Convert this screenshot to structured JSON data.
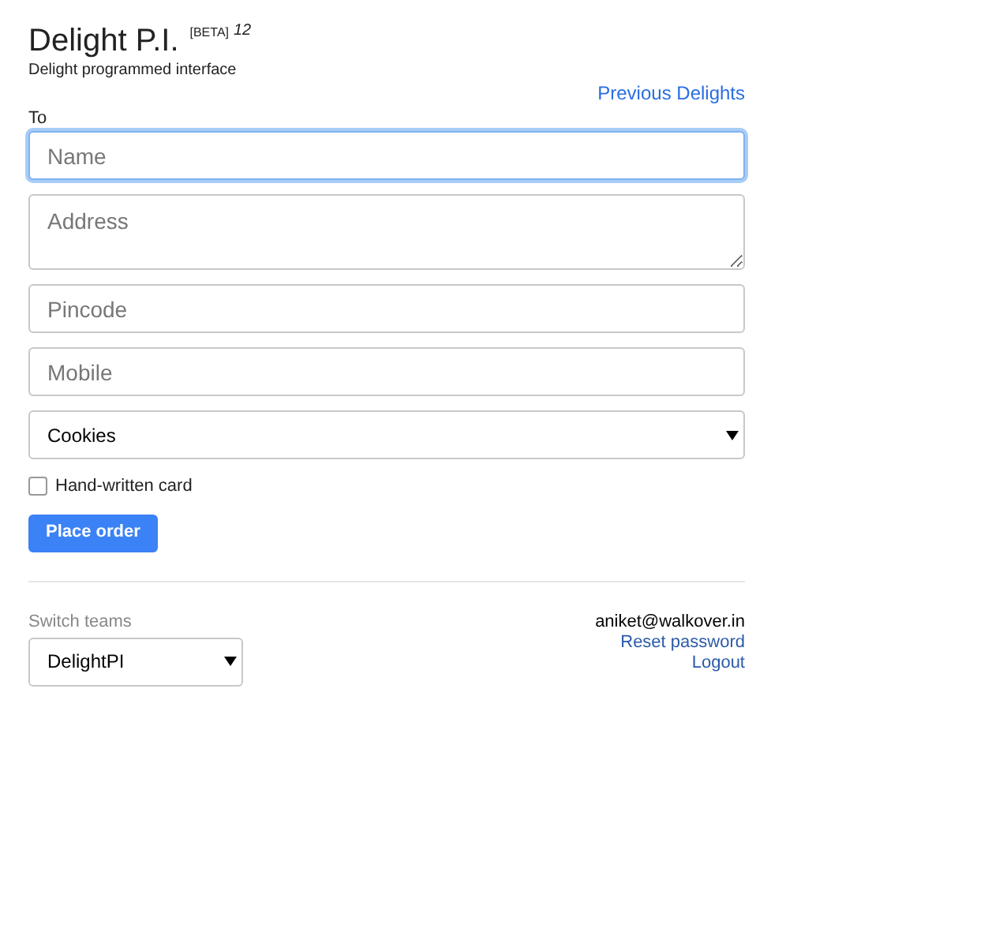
{
  "header": {
    "title": "Delight P.I.",
    "badge": "[BETA]",
    "version": "12",
    "subtitle": "Delight programmed interface"
  },
  "previous_link": "Previous Delights",
  "form": {
    "label": "To",
    "fields": [
      {
        "kind": "input",
        "placeholder": "Name",
        "focused": true
      },
      {
        "kind": "textarea",
        "placeholder": "Address",
        "focused": false
      },
      {
        "kind": "input",
        "placeholder": "Pincode",
        "focused": false
      },
      {
        "kind": "input",
        "placeholder": "Mobile",
        "focused": false
      },
      {
        "kind": "select",
        "value": "Cookies",
        "focused": false
      }
    ],
    "checkbox": {
      "label": "Hand-written card",
      "checked": false
    },
    "submit": "Place order"
  },
  "footer": {
    "switch_label": "Switch teams",
    "team": "DelightPI",
    "email": "aniket@walkover.in",
    "links": [
      "Reset password",
      "Logout"
    ]
  }
}
